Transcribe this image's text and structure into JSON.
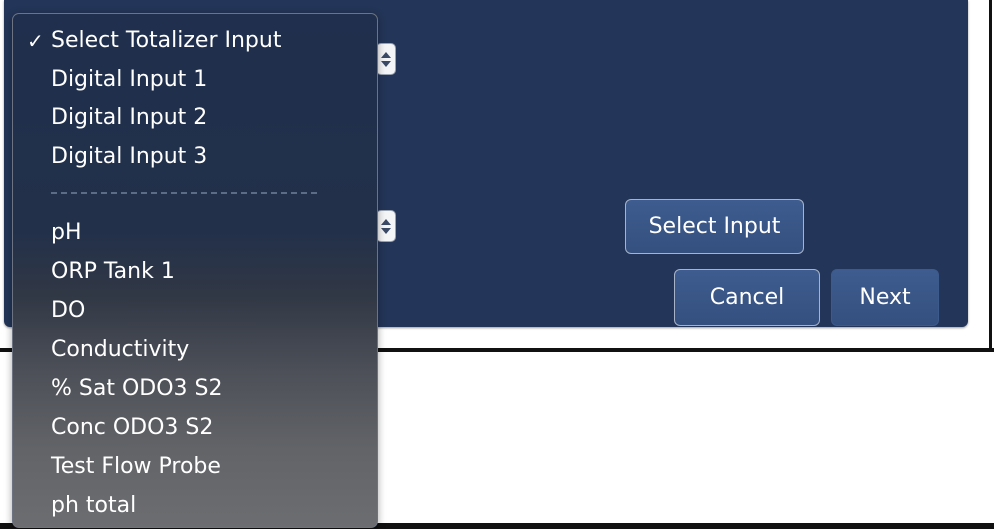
{
  "dialog": {
    "select_input_label": "Select Input",
    "cancel_label": "Cancel",
    "next_label": "Next"
  },
  "menu": {
    "checkmark": "✓",
    "selected_index": 0,
    "items": [
      "Select Totalizer Input",
      "Digital Input 1",
      "Digital Input 2",
      "Digital Input 3",
      "pH",
      "ORP Tank 1",
      "DO",
      "Conductivity",
      "% Sat ODO3 S2",
      "Conc ODO3 S2",
      "Test Flow Probe",
      "ph total"
    ]
  },
  "colors": {
    "panel": "#233558",
    "button": "#3a5688",
    "menu_top": "#1f2f4d",
    "menu_bottom": "#6c6d70"
  }
}
